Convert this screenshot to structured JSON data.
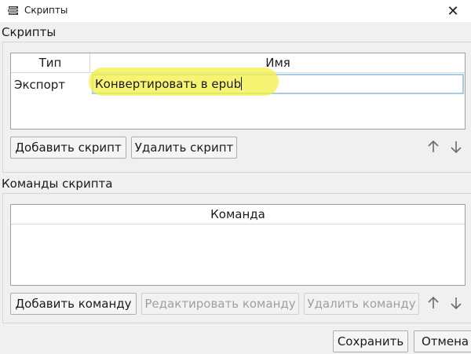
{
  "window": {
    "title": "Скрипты",
    "icon": "books-app-icon",
    "close_glyph": "✕"
  },
  "scripts_group": {
    "title": "Скрипты",
    "columns": [
      "Тип",
      "Имя"
    ],
    "rows": [
      {
        "type": "Экспорт",
        "name": "Конвертировать в epub"
      }
    ],
    "add_button": "Добавить скрипт",
    "delete_button": "Удалить скрипт",
    "move_up_icon": "arrow-up-icon",
    "move_down_icon": "arrow-down-icon"
  },
  "commands_group": {
    "title": "Команды скрипта",
    "columns": [
      "Команда"
    ],
    "rows": [],
    "add_button": "Добавить команду",
    "edit_button": "Редактировать команду",
    "delete_button": "Удалить команду",
    "move_up_icon": "arrow-up-icon",
    "move_down_icon": "arrow-down-icon"
  },
  "footer": {
    "save_button": "Сохранить",
    "cancel_button": "Отмена"
  },
  "colors": {
    "highlight": "#f5f044",
    "edit_border": "#a7cbe6",
    "arrow": "#6b6b6b"
  }
}
